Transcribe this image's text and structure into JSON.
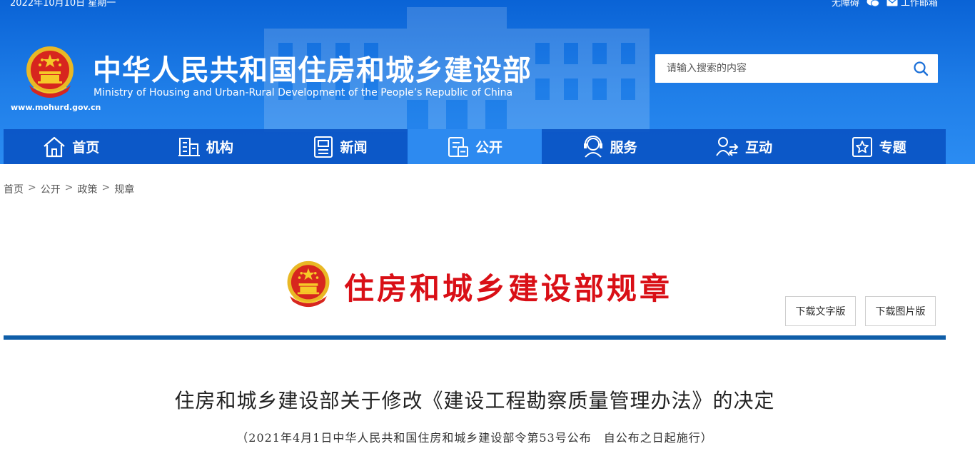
{
  "topbar": {
    "date": "2022年10月10日 星期一",
    "accessibility": "无障碍",
    "mail": "工作邮箱"
  },
  "site": {
    "url": "www.mohurd.gov.cn",
    "title_cn": "中华人民共和国住房和城乡建设部",
    "title_en": "Ministry of Housing and Urban-Rural Development of the People’s Republic of China"
  },
  "search": {
    "placeholder": "请输入搜索的内容",
    "value": ""
  },
  "nav": {
    "items": [
      {
        "label": "首页",
        "icon": "home-icon"
      },
      {
        "label": "机构",
        "icon": "building-icon"
      },
      {
        "label": "新闻",
        "icon": "news-icon"
      },
      {
        "label": "公开",
        "icon": "disclosure-icon"
      },
      {
        "label": "服务",
        "icon": "service-icon"
      },
      {
        "label": "互动",
        "icon": "interaction-icon"
      },
      {
        "label": "专题",
        "icon": "star-icon"
      }
    ],
    "active_index": 3
  },
  "breadcrumb": [
    "首页",
    "公开",
    "政策",
    "规章"
  ],
  "breadcrumb_separator": ">",
  "banner": {
    "title": "住房和城乡建设部规章",
    "download_text": "下载文字版",
    "download_image": "下载图片版"
  },
  "document": {
    "title": "住房和城乡建设部关于修改《建设工程勘察质量管理办法》的决定",
    "subtitle": "（2021年4月1日中华人民共和国住房和城乡建设部令第53号公布　自公布之日起施行）"
  },
  "colors": {
    "header_blue": "#1f7ee8",
    "nav_blue": "#0a54c4",
    "nav_active": "#2d8af0",
    "banner_red": "#d90f16",
    "divider_blue": "#0f5ea8"
  }
}
